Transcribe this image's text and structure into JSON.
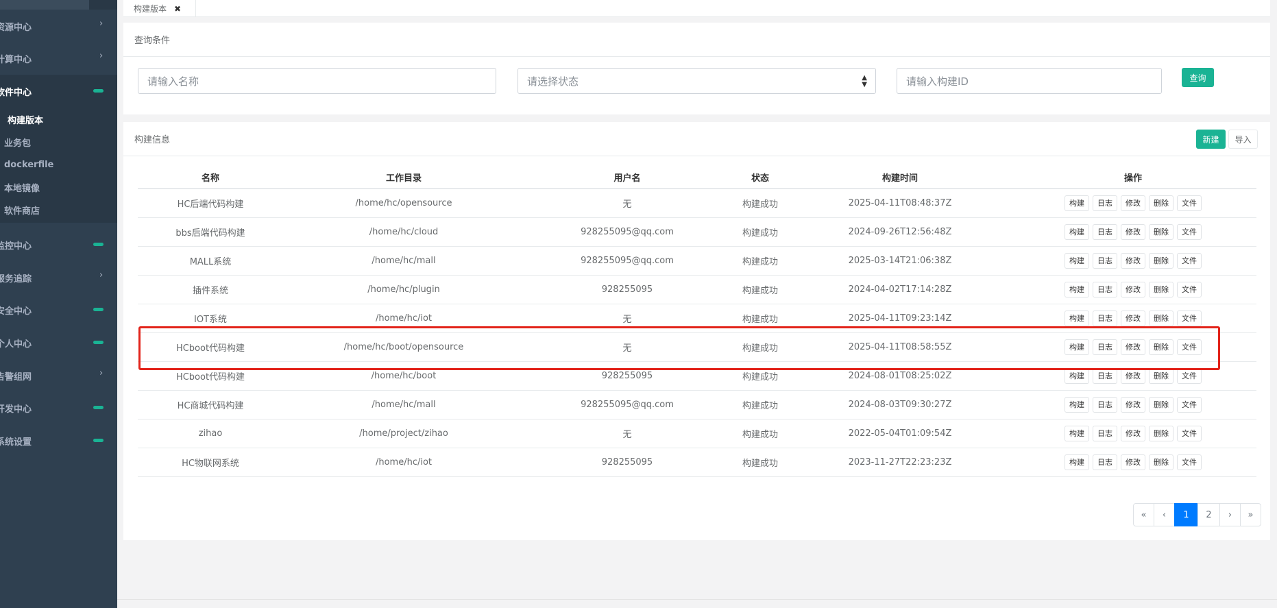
{
  "sidebar": {
    "items": [
      {
        "label": "资源中心",
        "marker": "arrow"
      },
      {
        "label": "计算中心",
        "marker": "arrow"
      },
      {
        "label": "软件中心",
        "marker": "pill",
        "active": true
      },
      {
        "label": "监控中心",
        "marker": "pill"
      },
      {
        "label": "服务追踪",
        "marker": "arrow"
      },
      {
        "label": "安全中心",
        "marker": "pill"
      },
      {
        "label": "个人中心",
        "marker": "pill"
      },
      {
        "label": "告警组网",
        "marker": "arrow"
      },
      {
        "label": "开发中心",
        "marker": "pill"
      },
      {
        "label": "系统设置",
        "marker": "pill"
      }
    ],
    "submenu": [
      {
        "label": "构建版本",
        "active": true
      },
      {
        "label": "业务包"
      },
      {
        "label": "dockerfile"
      },
      {
        "label": "本地镜像"
      },
      {
        "label": "软件商店"
      }
    ],
    "arrow_glyph": "›"
  },
  "tabbar": {
    "tab_label": "构建版本",
    "close_glyph": "✖"
  },
  "query": {
    "title": "查询条件",
    "name_placeholder": "请输入名称",
    "status_placeholder": "请选择状态",
    "build_id_placeholder": "请输入构建ID",
    "search_label": "查询"
  },
  "list": {
    "title": "构建信息",
    "new_label": "新建",
    "import_label": "导入",
    "columns": [
      "名称",
      "工作目录",
      "用户名",
      "状态",
      "构建时间",
      "操作"
    ],
    "action_labels": [
      "构建",
      "日志",
      "修改",
      "删除",
      "文件"
    ],
    "rows": [
      [
        "HC后端代码构建",
        "/home/hc/opensource",
        "无",
        "构建成功",
        "2025-04-11T08:48:37Z"
      ],
      [
        "bbs后端代码构建",
        "/home/hc/cloud",
        "928255095@qq.com",
        "构建成功",
        "2024-09-26T12:56:48Z"
      ],
      [
        "MALL系统",
        "/home/hc/mall",
        "928255095@qq.com",
        "构建成功",
        "2025-03-14T21:06:38Z"
      ],
      [
        "插件系统",
        "/home/hc/plugin",
        "928255095",
        "构建成功",
        "2024-04-02T17:14:28Z"
      ],
      [
        "IOT系统",
        "/home/hc/iot",
        "无",
        "构建成功",
        "2025-04-11T09:23:14Z"
      ],
      [
        "HCboot代码构建",
        "/home/hc/boot/opensource",
        "无",
        "构建成功",
        "2025-04-11T08:58:55Z"
      ],
      [
        "HCboot代码构建",
        "/home/hc/boot",
        "928255095",
        "构建成功",
        "2024-08-01T08:25:02Z"
      ],
      [
        "HC商城代码构建",
        "/home/hc/mall",
        "928255095@qq.com",
        "构建成功",
        "2024-08-03T09:30:27Z"
      ],
      [
        "zihao",
        "/home/project/zihao",
        "无",
        "构建成功",
        "2022-05-04T01:09:54Z"
      ],
      [
        "HC物联网系统",
        "/home/hc/iot",
        "928255095",
        "构建成功",
        "2023-11-27T22:23:23Z"
      ]
    ]
  },
  "pagination": {
    "first": "«",
    "prev": "‹",
    "pages": [
      "1",
      "2"
    ],
    "current": "1",
    "next": "›",
    "last": "»"
  },
  "colors": {
    "sidebar_bg": "#2f4050",
    "accent": "#1ab394",
    "highlight": "#e2231a",
    "page_active": "#007bff"
  }
}
